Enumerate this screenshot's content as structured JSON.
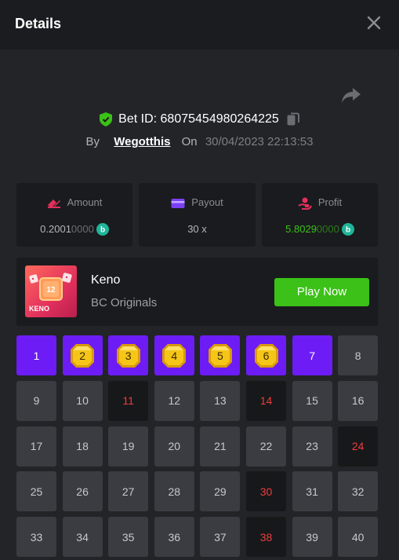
{
  "header": {
    "title": "Details"
  },
  "bet": {
    "id_label": "Bet ID:",
    "id": "68075454980264225",
    "by_label": "By",
    "user": "Wegotthis",
    "on_label": "On",
    "date": "30/04/2023 22:13:53"
  },
  "stats": {
    "amount": {
      "label": "Amount",
      "value_main": "0.2001",
      "value_dim": "0000"
    },
    "payout": {
      "label": "Payout",
      "value": "30 x"
    },
    "profit": {
      "label": "Profit",
      "value_main": "5.8029",
      "value_dim": "0000"
    }
  },
  "game": {
    "name": "Keno",
    "provider": "BC Originals",
    "thumb_label": "KENO",
    "thumb_number": "12",
    "play_label": "Play Now"
  },
  "grid": {
    "cells": [
      {
        "n": "1",
        "s": "picked"
      },
      {
        "n": "2",
        "s": "hit"
      },
      {
        "n": "3",
        "s": "hit"
      },
      {
        "n": "4",
        "s": "hit"
      },
      {
        "n": "5",
        "s": "hit"
      },
      {
        "n": "6",
        "s": "hit"
      },
      {
        "n": "7",
        "s": "picked"
      },
      {
        "n": "8",
        "s": "none"
      },
      {
        "n": "9",
        "s": "none"
      },
      {
        "n": "10",
        "s": "none"
      },
      {
        "n": "11",
        "s": "drawn"
      },
      {
        "n": "12",
        "s": "none"
      },
      {
        "n": "13",
        "s": "none"
      },
      {
        "n": "14",
        "s": "drawn"
      },
      {
        "n": "15",
        "s": "none"
      },
      {
        "n": "16",
        "s": "none"
      },
      {
        "n": "17",
        "s": "none"
      },
      {
        "n": "18",
        "s": "none"
      },
      {
        "n": "19",
        "s": "none"
      },
      {
        "n": "20",
        "s": "none"
      },
      {
        "n": "21",
        "s": "none"
      },
      {
        "n": "22",
        "s": "none"
      },
      {
        "n": "23",
        "s": "none"
      },
      {
        "n": "24",
        "s": "drawn"
      },
      {
        "n": "25",
        "s": "none"
      },
      {
        "n": "26",
        "s": "none"
      },
      {
        "n": "27",
        "s": "none"
      },
      {
        "n": "28",
        "s": "none"
      },
      {
        "n": "29",
        "s": "none"
      },
      {
        "n": "30",
        "s": "drawn"
      },
      {
        "n": "31",
        "s": "none"
      },
      {
        "n": "32",
        "s": "none"
      },
      {
        "n": "33",
        "s": "none"
      },
      {
        "n": "34",
        "s": "none"
      },
      {
        "n": "35",
        "s": "none"
      },
      {
        "n": "36",
        "s": "none"
      },
      {
        "n": "37",
        "s": "none"
      },
      {
        "n": "38",
        "s": "drawn"
      },
      {
        "n": "39",
        "s": "none"
      },
      {
        "n": "40",
        "s": "none"
      }
    ]
  },
  "colors": {
    "accent_green": "#3bc117",
    "picked_purple": "#6d1cf5",
    "drawn_red": "#ef3d3d",
    "gem_gold": "#f5c518"
  }
}
